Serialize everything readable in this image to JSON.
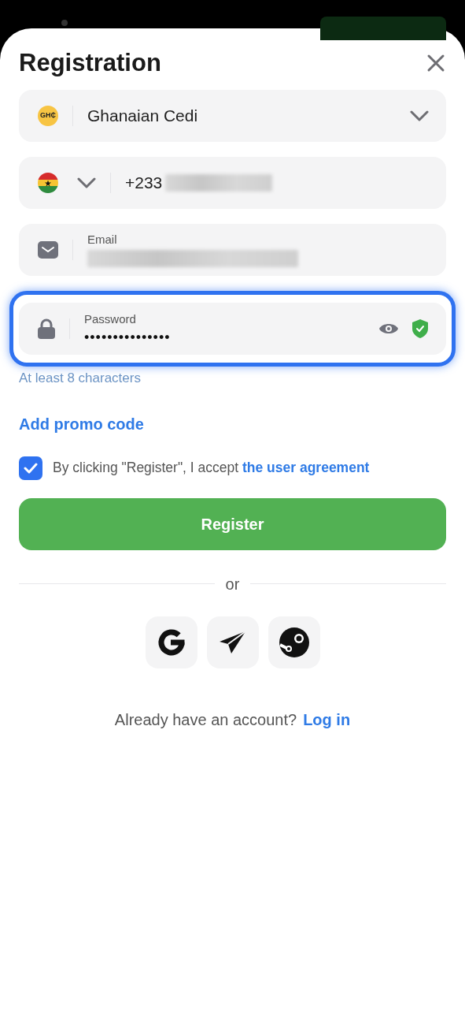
{
  "dialog": {
    "title": "Registration"
  },
  "fields": [
    {
      "kind": "currency",
      "value": "Ghanaian Cedi",
      "badge": "GH₵"
    },
    {
      "kind": "phone",
      "value": "+233",
      "redacted": true
    },
    {
      "kind": "email",
      "label": "Email",
      "redacted": true,
      "focused": false
    },
    {
      "kind": "password",
      "label": "Password",
      "value": "•••••••••••••••",
      "valid": true,
      "focused": true
    }
  ],
  "password_hint": "At least 8 characters",
  "promo_link": "Add promo code",
  "agreement": {
    "checked": true,
    "text": "By clicking \"Register\", I accept",
    "link": "the user agreement"
  },
  "register_button": "Register",
  "divider_text": "or",
  "social_buttons": [
    {
      "kind": "google"
    },
    {
      "kind": "telegram"
    },
    {
      "kind": "steam"
    }
  ],
  "login_prompt": {
    "text": "Already have an account?",
    "link": "Log in"
  }
}
